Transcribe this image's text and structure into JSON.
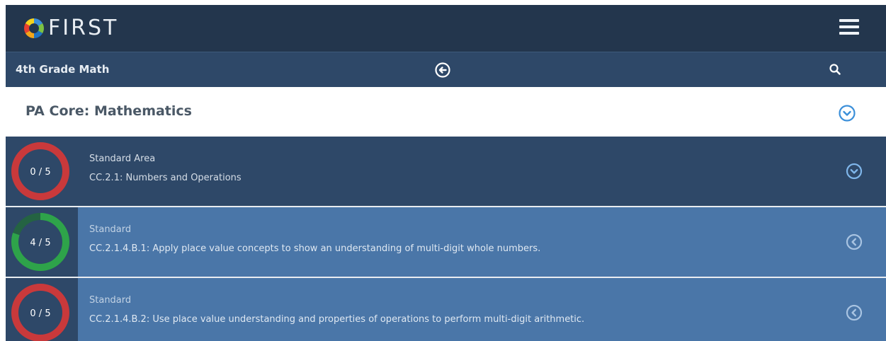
{
  "app": {
    "brand": "FIRST"
  },
  "subbar": {
    "course_title": "4th Grade Math"
  },
  "header": {
    "title": "PA Core: Mathematics"
  },
  "rows": [
    {
      "progress_label": "0 / 5",
      "progress_done": 0,
      "progress_total": 5,
      "type": "Standard Area",
      "text": "CC.2.1: Numbers and Operations",
      "state": "expanded"
    },
    {
      "progress_label": "4 / 5",
      "progress_done": 4,
      "progress_total": 5,
      "type": "Standard",
      "text": "CC.2.1.4.B.1: Apply place value concepts to show an understanding of multi-digit whole numbers.",
      "state": "collapsed"
    },
    {
      "progress_label": "0 / 5",
      "progress_done": 0,
      "progress_total": 5,
      "type": "Standard",
      "text": "CC.2.1.4.B.2: Use place value understanding and properties of operations to perform multi-digit arithmetic.",
      "state": "collapsed"
    }
  ],
  "colors": {
    "topbar": "#23364d",
    "subbar": "#2e4868",
    "row_light": "#4a76a8",
    "accent": "#3b8fd9",
    "progress_incomplete": "#c9393b",
    "progress_complete": "#2ea34a"
  },
  "icons": {
    "logo": "first-logo-icon",
    "menu": "hamburger-menu-icon",
    "back": "back-arrow-circle-icon",
    "search": "search-icon",
    "expand": "chevron-down-circle-icon",
    "collapse": "chevron-left-circle-icon"
  }
}
